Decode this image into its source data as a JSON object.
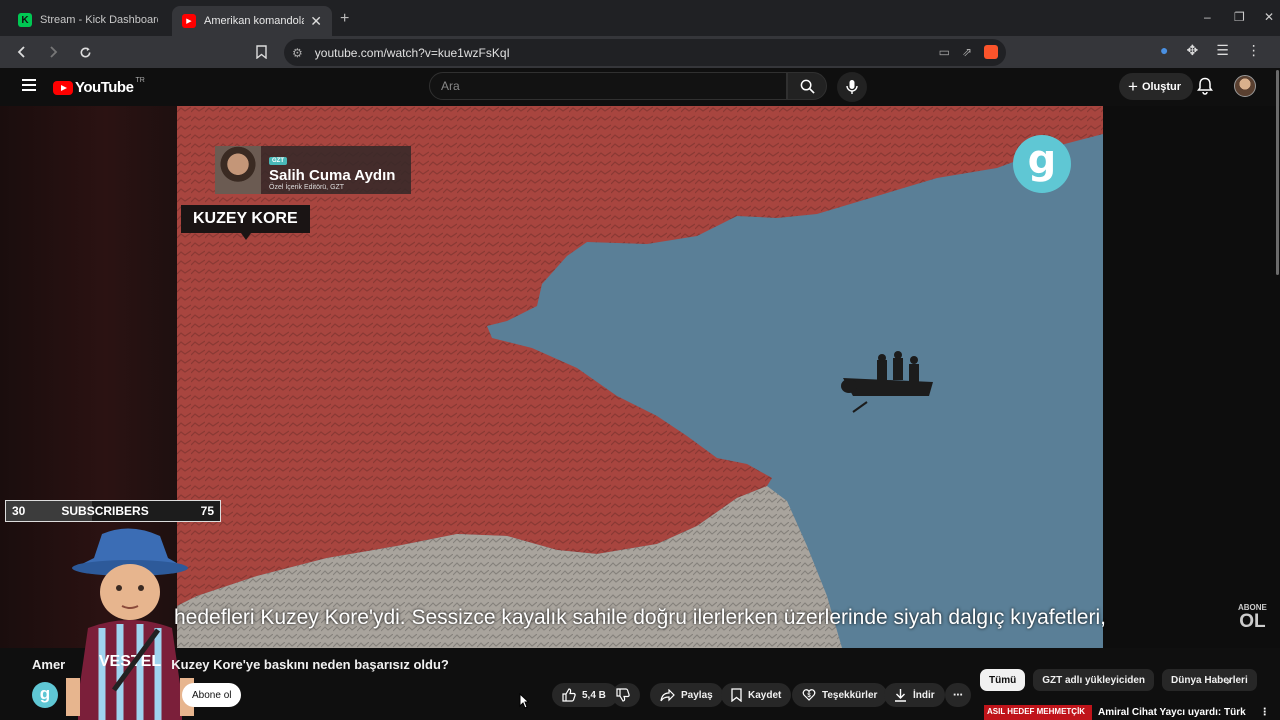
{
  "browser": {
    "tabs": [
      {
        "title": "Stream - Kick Dashboard",
        "icon": "kick-icon"
      },
      {
        "title": "Amerikan komandolarının K",
        "icon": "youtube-icon"
      }
    ],
    "new_tab": "+",
    "url": "youtube.com/watch?v=kue1wzFsKqI"
  },
  "youtube": {
    "logo_text": "YouTube",
    "country": "TR",
    "search_placeholder": "Ara",
    "create_label": "Oluştur"
  },
  "video": {
    "presenter_tag": "GZT",
    "presenter_name": "Salih Cuma Aydın",
    "presenter_role": "Özel İçerik Editörü, GZT",
    "location_label": "KUZEY KORE",
    "logo_letter": "g",
    "caption": "hedefleri Kuzey Kore'ydi. Sessizce kayalık sahile doğru ilerlerken üzerlerinde siyah dalgıç kıyafetleri,",
    "abone_top": "ABONE",
    "abone_bottom": "OL"
  },
  "overlay": {
    "sub_current": "30",
    "sub_label": "SUBSCRIBERS",
    "sub_goal": "75",
    "progress": 0.4
  },
  "below": {
    "title_left": "Amer",
    "title_right": "Kuzey Kore'ye baskını neden başarısız oldu?",
    "channel_letter": "g",
    "subscribe_label": "Abone ol",
    "like_count": "5,4 B",
    "share_label": "Paylaş",
    "save_label": "Kaydet",
    "thanks_label": "Teşekkürler",
    "download_label": "İndir"
  },
  "chips": [
    "Tümü",
    "GZT adlı yükleyiciden",
    "Dünya Haberleri"
  ],
  "recommendation": {
    "thumb_text": "ASIL HEDEF MEHMETÇİK",
    "title": "Amiral Cihat Yaycı uyardı: Türk"
  },
  "colors": {
    "map_land": "#a8453f",
    "map_sea": "#5a7f97",
    "brand_gzt": "#5fc7d4",
    "youtube_red": "#ff0000"
  }
}
